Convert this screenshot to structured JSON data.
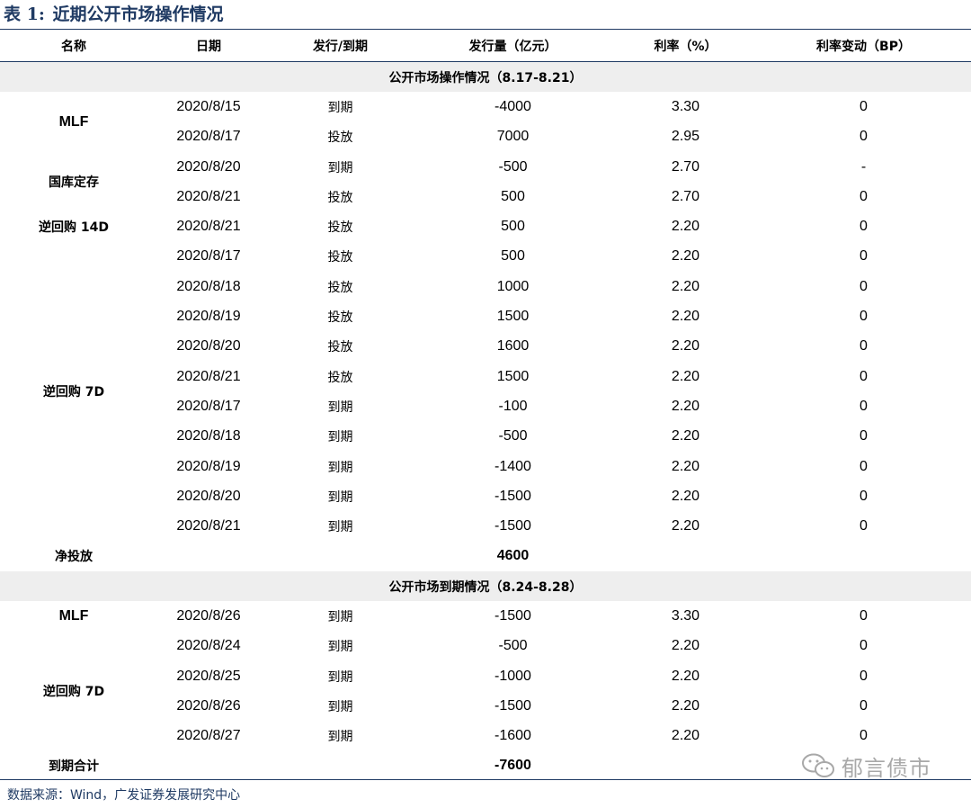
{
  "title": {
    "label": "表 1:",
    "text": "近期公开市场操作情况"
  },
  "columns": [
    "名称",
    "日期",
    "发行/到期",
    "发行量（亿元）",
    "利率（%）",
    "利率变动（BP）"
  ],
  "section1": {
    "heading": "公开市场操作情况（8.17-8.21）",
    "groups": [
      {
        "name": "MLF",
        "rows": [
          {
            "date": "2020/8/15",
            "type": "到期",
            "amount": "-4000",
            "rate": "3.30",
            "change": "0"
          },
          {
            "date": "2020/8/17",
            "type": "投放",
            "amount": "7000",
            "rate": "2.95",
            "change": "0"
          }
        ]
      },
      {
        "name": "国库定存",
        "rows": [
          {
            "date": "2020/8/20",
            "type": "到期",
            "amount": "-500",
            "rate": "2.70",
            "change": "-"
          },
          {
            "date": "2020/8/21",
            "type": "投放",
            "amount": "500",
            "rate": "2.70",
            "change": "0"
          }
        ]
      },
      {
        "name": "逆回购 14D",
        "rows": [
          {
            "date": "2020/8/21",
            "type": "投放",
            "amount": "500",
            "rate": "2.20",
            "change": "0"
          }
        ]
      },
      {
        "name": "逆回购 7D",
        "rows": [
          {
            "date": "2020/8/17",
            "type": "投放",
            "amount": "500",
            "rate": "2.20",
            "change": "0"
          },
          {
            "date": "2020/8/18",
            "type": "投放",
            "amount": "1000",
            "rate": "2.20",
            "change": "0"
          },
          {
            "date": "2020/8/19",
            "type": "投放",
            "amount": "1500",
            "rate": "2.20",
            "change": "0"
          },
          {
            "date": "2020/8/20",
            "type": "投放",
            "amount": "1600",
            "rate": "2.20",
            "change": "0"
          },
          {
            "date": "2020/8/21",
            "type": "投放",
            "amount": "1500",
            "rate": "2.20",
            "change": "0"
          },
          {
            "date": "2020/8/17",
            "type": "到期",
            "amount": "-100",
            "rate": "2.20",
            "change": "0"
          },
          {
            "date": "2020/8/18",
            "type": "到期",
            "amount": "-500",
            "rate": "2.20",
            "change": "0"
          },
          {
            "date": "2020/8/19",
            "type": "到期",
            "amount": "-1400",
            "rate": "2.20",
            "change": "0"
          },
          {
            "date": "2020/8/20",
            "type": "到期",
            "amount": "-1500",
            "rate": "2.20",
            "change": "0"
          },
          {
            "date": "2020/8/21",
            "type": "到期",
            "amount": "-1500",
            "rate": "2.20",
            "change": "0"
          }
        ]
      }
    ],
    "total": {
      "label": "净投放",
      "amount": "4600"
    }
  },
  "section2": {
    "heading": "公开市场到期情况（8.24-8.28）",
    "groups": [
      {
        "name": "MLF",
        "rows": [
          {
            "date": "2020/8/26",
            "type": "到期",
            "amount": "-1500",
            "rate": "3.30",
            "change": "0"
          }
        ]
      },
      {
        "name": "逆回购 7D",
        "rows": [
          {
            "date": "2020/8/24",
            "type": "到期",
            "amount": "-500",
            "rate": "2.20",
            "change": "0"
          },
          {
            "date": "2020/8/25",
            "type": "到期",
            "amount": "-1000",
            "rate": "2.20",
            "change": "0"
          },
          {
            "date": "2020/8/26",
            "type": "到期",
            "amount": "-1500",
            "rate": "2.20",
            "change": "0"
          },
          {
            "date": "2020/8/27",
            "type": "到期",
            "amount": "-1600",
            "rate": "2.20",
            "change": "0"
          }
        ]
      }
    ],
    "total": {
      "label": "到期合计",
      "amount": "-7600"
    }
  },
  "source": "数据来源：Wind，广发证券发展研究中心",
  "watermark": {
    "text": "郁言债市",
    "icon": "wechat-icon"
  },
  "colors": {
    "accent": "#1f3a63",
    "section_bg": "#eeeeee"
  }
}
